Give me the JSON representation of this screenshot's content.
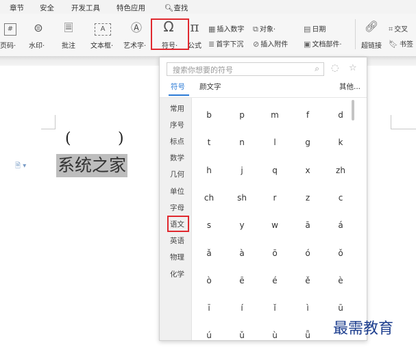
{
  "menu_tabs": [
    "章节",
    "安全",
    "开发工具",
    "特色应用",
    "查找"
  ],
  "ribbon": {
    "large_buttons": [
      {
        "label": "页码·",
        "icon": "page-number-icon"
      },
      {
        "label": "水印·",
        "icon": "watermark-icon"
      },
      {
        "label": "批注",
        "icon": "comment-icon"
      },
      {
        "label": "文本框·",
        "icon": "textbox-icon"
      },
      {
        "label": "艺术字·",
        "icon": "wordart-icon"
      },
      {
        "label": "符号·",
        "icon": "omega-symbol-icon"
      },
      {
        "label": "公式",
        "icon": "pi-formula-icon"
      }
    ],
    "small_buttons": [
      {
        "label": "插入数字",
        "icon": "insert-number-icon"
      },
      {
        "label": "对象·",
        "icon": "object-icon"
      },
      {
        "label": "日期",
        "icon": "date-icon"
      },
      {
        "label": "首字下沉",
        "icon": "drop-cap-icon"
      },
      {
        "label": "插入附件",
        "icon": "attachment-icon"
      },
      {
        "label": "文档部件·",
        "icon": "document-parts-icon"
      }
    ],
    "right_buttons": [
      {
        "label": "超链接",
        "icon": "hyperlink-icon"
      },
      {
        "label": "书签",
        "icon": "bookmark-icon"
      },
      {
        "label": "交叉",
        "icon": "cross-reference-icon"
      }
    ]
  },
  "document": {
    "paren_open": "(",
    "paren_close": ")",
    "selected_text": "系统之家"
  },
  "symbol_panel": {
    "search_placeholder": "搜索你想要的符号",
    "tabs": [
      "符号",
      "颜文字"
    ],
    "more_label": "其他...",
    "categories": [
      "常用",
      "序号",
      "标点",
      "数学",
      "几何",
      "单位",
      "字母",
      "语文",
      "英语",
      "物理",
      "化学"
    ],
    "selected_category": "语文",
    "symbols": [
      [
        "b",
        "p",
        "m",
        "f",
        "d"
      ],
      [
        "t",
        "n",
        "l",
        "g",
        "k"
      ],
      [
        "h",
        "j",
        "q",
        "x",
        "zh"
      ],
      [
        "ch",
        "sh",
        "r",
        "z",
        "c"
      ],
      [
        "s",
        "y",
        "w",
        "ā",
        "á"
      ],
      [
        "ǎ",
        "à",
        "ō",
        "ó",
        "ǒ"
      ],
      [
        "ò",
        "ē",
        "é",
        "ě",
        "è"
      ],
      [
        "ī",
        "í",
        "ǐ",
        "ì",
        "ū"
      ],
      [
        "ú",
        "ǔ",
        "ù",
        "ǖ",
        ""
      ]
    ]
  },
  "watermark": "最需教育",
  "colors": {
    "highlight_red": "#e0282e",
    "active_blue": "#2a7ad6",
    "watermark_blue": "#1e3f8f"
  }
}
